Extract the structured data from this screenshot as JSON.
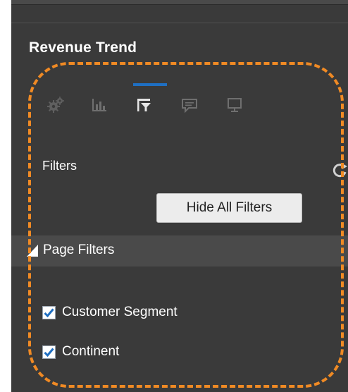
{
  "panel": {
    "title": "Revenue Trend",
    "toolbar": [
      {
        "name": "settings",
        "icon": "gears-icon",
        "active": false
      },
      {
        "name": "chart",
        "icon": "bar-chart-icon",
        "active": false
      },
      {
        "name": "filters",
        "icon": "filter-icon",
        "active": true
      },
      {
        "name": "comments",
        "icon": "speech-bubble-icon",
        "active": false
      },
      {
        "name": "presentation",
        "icon": "presentation-board-icon",
        "active": false
      }
    ],
    "filters_label": "Filters",
    "hide_all_filters_label": "Hide All Filters",
    "page_filters_label": "Page Filters",
    "filters": [
      {
        "label": "Customer Segment",
        "checked": true
      },
      {
        "label": "Continent",
        "checked": true
      }
    ]
  },
  "colors": {
    "panel_bg": "#3a3a3a",
    "active_tab": "#1f6fc2",
    "highlight_outline": "#f08a24",
    "checkmark": "#1f6fc2"
  }
}
